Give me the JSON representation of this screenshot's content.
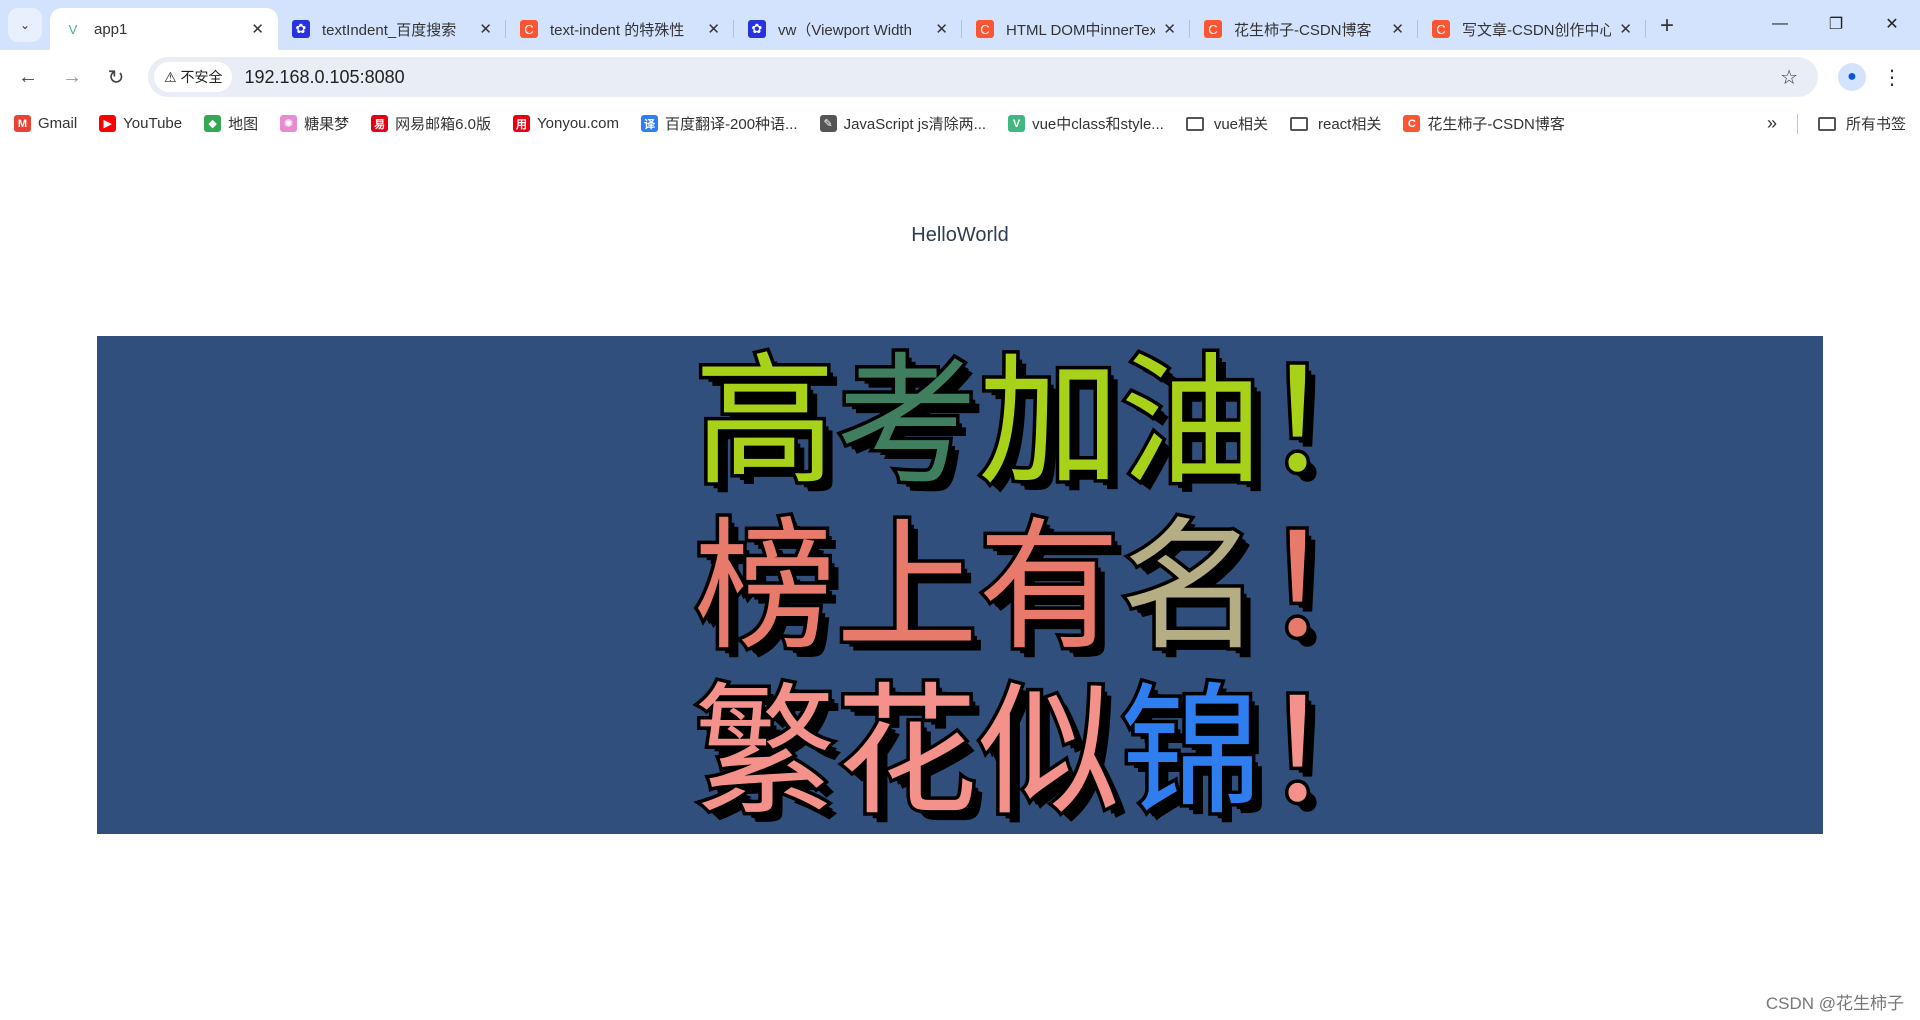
{
  "browser": {
    "tabs": [
      {
        "title": "app1",
        "icon": "vue-icon",
        "color": "#41b883",
        "active": true
      },
      {
        "title": "textIndent_百度搜索",
        "icon": "baidu-icon",
        "color": "#2932e1"
      },
      {
        "title": "text-indent 的特殊性",
        "icon": "csdn-icon",
        "color": "#fc5531"
      },
      {
        "title": "vw（Viewport Width",
        "icon": "baidu-icon",
        "color": "#2932e1"
      },
      {
        "title": "HTML DOM中innerText",
        "icon": "csdn-icon",
        "color": "#fc5531"
      },
      {
        "title": "花生柿子-CSDN博客",
        "icon": "csdn-icon",
        "color": "#fc5531"
      },
      {
        "title": "写文章-CSDN创作中心",
        "icon": "csdn-icon",
        "color": "#fc5531"
      }
    ],
    "insecure_label": "不安全",
    "url": "192.168.0.105:8080",
    "bookmarks": [
      {
        "label": "Gmail",
        "icon": "gmail-icon",
        "color": "#ea4335"
      },
      {
        "label": "YouTube",
        "icon": "youtube-icon",
        "color": "#ff0000"
      },
      {
        "label": "地图",
        "icon": "maps-icon",
        "color": "#34a853"
      },
      {
        "label": "糖果梦",
        "icon": "candy-icon",
        "color": "#e98bd0"
      },
      {
        "label": "网易邮箱6.0版",
        "icon": "netease-icon",
        "color": "#e60012"
      },
      {
        "label": "Yonyou.com",
        "icon": "yonyou-icon",
        "color": "#e60012"
      },
      {
        "label": "百度翻译-200种语...",
        "icon": "baidu-translate-icon",
        "color": "#2f7cf6"
      },
      {
        "label": "JavaScript js清除两...",
        "icon": "js-icon",
        "color": "#555555"
      },
      {
        "label": "vue中class和style...",
        "icon": "vue-icon",
        "color": "#41b883"
      },
      {
        "label": "vue相关",
        "icon": "folder-icon"
      },
      {
        "label": "react相关",
        "icon": "folder-icon"
      },
      {
        "label": "花生柿子-CSDN博客",
        "icon": "csdn-icon",
        "color": "#fc5531"
      }
    ],
    "all_bookmarks": "所有书签"
  },
  "page": {
    "title": "HelloWorld",
    "background": "#314f7c",
    "lines": [
      [
        {
          "c": "高",
          "color": "#a8d11a"
        },
        {
          "c": "考",
          "color": "#3f7f5f"
        },
        {
          "c": "加",
          "color": "#a8d11a"
        },
        {
          "c": "油",
          "color": "#a8d11a"
        },
        {
          "c": "！",
          "color": "#a8d11a"
        }
      ],
      [
        {
          "c": "榜",
          "color": "#e87a6c"
        },
        {
          "c": "上",
          "color": "#e87a6c"
        },
        {
          "c": "有",
          "color": "#e87a6c"
        },
        {
          "c": "名",
          "color": "#b5ae84"
        },
        {
          "c": "！",
          "color": "#e87a6c"
        }
      ],
      [
        {
          "c": "繁",
          "color": "#f4918a"
        },
        {
          "c": "花",
          "color": "#f4918a"
        },
        {
          "c": "似",
          "color": "#f4918a"
        },
        {
          "c": "锦",
          "color": "#2f7ef0"
        },
        {
          "c": "！",
          "color": "#f4918a"
        }
      ]
    ]
  },
  "watermark": "CSDN @花生柿子"
}
